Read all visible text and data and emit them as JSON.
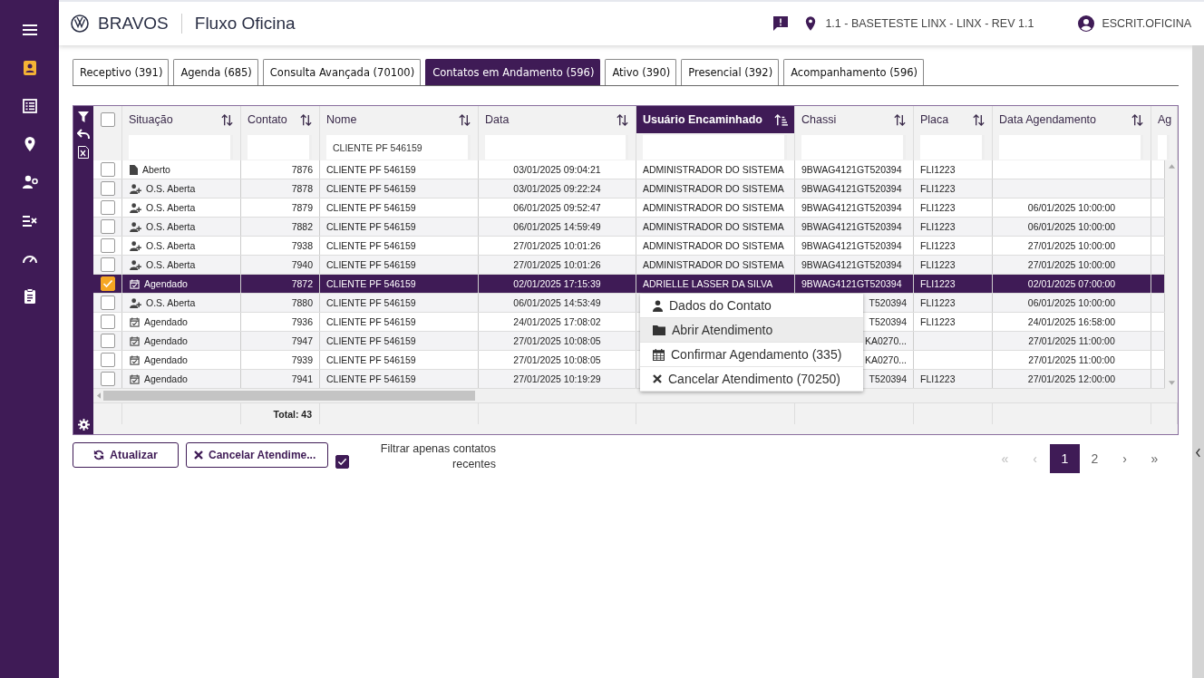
{
  "sidebar": {
    "items": [
      {
        "kind": "menu",
        "selected": false
      },
      {
        "kind": "contact",
        "selected": true
      },
      {
        "kind": "list",
        "selected": false
      },
      {
        "kind": "pin",
        "selected": false
      },
      {
        "kind": "user-gear",
        "selected": false
      },
      {
        "kind": "checklist",
        "selected": false
      },
      {
        "kind": "gauge",
        "selected": false
      },
      {
        "kind": "clipboard",
        "selected": false
      }
    ]
  },
  "header": {
    "brand": "BRAVOS",
    "title": "Fluxo Oficina",
    "location": "1.1 - BASETESTE LINX - LINX - REV 1.1",
    "user": "ESCRIT.OFICINA"
  },
  "tabs": [
    {
      "label": "Receptivo (391)",
      "selected": false
    },
    {
      "label": "Agenda (685)",
      "selected": false
    },
    {
      "label": "Consulta Avançada (70100)",
      "selected": false
    },
    {
      "label": "Contatos em Andamento (596)",
      "selected": true
    },
    {
      "label": "Ativo (390)",
      "selected": false
    },
    {
      "label": "Presencial (392)",
      "selected": false
    },
    {
      "label": "Acompanhamento (596)",
      "selected": false
    }
  ],
  "table": {
    "columns": [
      {
        "label": "Situação",
        "selected": false
      },
      {
        "label": "Contato",
        "selected": false
      },
      {
        "label": "Nome",
        "selected": false,
        "filter": "CLIENTE PF 546159"
      },
      {
        "label": "Data",
        "selected": false
      },
      {
        "label": "Usuário Encaminhado",
        "selected": true
      },
      {
        "label": "Chassi",
        "selected": false
      },
      {
        "label": "Placa",
        "selected": false
      },
      {
        "label": "Data Agendamento",
        "selected": false
      },
      {
        "label": "Ag",
        "selected": false
      }
    ],
    "select_all_checked": false,
    "rows": [
      {
        "checked": false,
        "selected": false,
        "kind": "open",
        "status": "Aberto",
        "contato": "7876",
        "nome": "CLIENTE PF 546159",
        "data": "03/01/2025 09:04:21",
        "usuario": "ADMINISTRADOR DO SISTEMA",
        "chassi": "9BWAG4121GT520394",
        "placa": "FLI1223"
      },
      {
        "checked": false,
        "selected": false,
        "kind": "os",
        "status": "O.S. Aberta",
        "contato": "7878",
        "nome": "CLIENTE PF 546159",
        "data": "03/01/2025 09:22:24",
        "usuario": "ADMINISTRADOR DO SISTEMA",
        "chassi": "9BWAG4121GT520394",
        "placa": "FLI1223"
      },
      {
        "checked": false,
        "selected": false,
        "kind": "os",
        "status": "O.S. Aberta",
        "contato": "7879",
        "nome": "CLIENTE PF 546159",
        "data": "06/01/2025 09:52:47",
        "usuario": "ADMINISTRADOR DO SISTEMA",
        "chassi": "9BWAG4121GT520394",
        "placa": "FLI1223",
        "agendamento": "06/01/2025 10:00:00"
      },
      {
        "checked": false,
        "selected": false,
        "kind": "os",
        "status": "O.S. Aberta",
        "contato": "7882",
        "nome": "CLIENTE PF 546159",
        "data": "06/01/2025 14:59:49",
        "usuario": "ADMINISTRADOR DO SISTEMA",
        "chassi": "9BWAG4121GT520394",
        "placa": "FLI1223",
        "agendamento": "06/01/2025 10:00:00"
      },
      {
        "checked": false,
        "selected": false,
        "kind": "os",
        "status": "O.S. Aberta",
        "contato": "7938",
        "nome": "CLIENTE PF 546159",
        "data": "27/01/2025 10:01:26",
        "usuario": "ADMINISTRADOR DO SISTEMA",
        "chassi": "9BWAG4121GT520394",
        "placa": "FLI1223",
        "agendamento": "27/01/2025 10:00:00"
      },
      {
        "checked": false,
        "selected": false,
        "kind": "os",
        "status": "O.S. Aberta",
        "contato": "7940",
        "nome": "CLIENTE PF 546159",
        "data": "27/01/2025 10:01:26",
        "usuario": "ADMINISTRADOR DO SISTEMA",
        "chassi": "9BWAG4121GT520394",
        "placa": "FLI1223",
        "agendamento": "27/01/2025 10:00:00"
      },
      {
        "checked": true,
        "selected": true,
        "kind": "scheduled",
        "status": "Agendado",
        "contato": "7872",
        "nome": "CLIENTE PF 546159",
        "data": "02/01/2025 17:15:39",
        "usuario": "ADRIELLE LASSER DA SILVA",
        "chassi": "9BWAG4121GT520394",
        "placa": "FLI1223",
        "agendamento": "02/01/2025 07:00:00"
      },
      {
        "checked": false,
        "selected": false,
        "kind": "os",
        "status": "O.S. Aberta",
        "contato": "7880",
        "nome": "CLIENTE PF 546159",
        "data": "06/01/2025 14:53:49",
        "chassi": "T520394",
        "chassi_partial": true,
        "placa": "FLI1223",
        "agendamento": "06/01/2025 10:00:00"
      },
      {
        "checked": false,
        "selected": false,
        "kind": "scheduled",
        "status": "Agendado",
        "contato": "7936",
        "nome": "CLIENTE PF 546159",
        "data": "24/01/2025 17:08:02",
        "chassi": "T520394",
        "chassi_partial": true,
        "placa": "FLI1223",
        "agendamento": "24/01/2025 16:58:00"
      },
      {
        "checked": false,
        "selected": false,
        "kind": "scheduled",
        "status": "Agendado",
        "contato": "7947",
        "nome": "CLIENTE PF 546159",
        "data": "27/01/2025 10:08:05",
        "chassi": "KA0270...",
        "chassi_partial": true,
        "agendamento": "27/01/2025 11:00:00"
      },
      {
        "checked": false,
        "selected": false,
        "kind": "scheduled",
        "status": "Agendado",
        "contato": "7939",
        "nome": "CLIENTE PF 546159",
        "data": "27/01/2025 10:08:05",
        "chassi": "KA0270...",
        "chassi_partial": true,
        "agendamento": "27/01/2025 11:00:00"
      },
      {
        "checked": false,
        "selected": false,
        "kind": "scheduled",
        "status": "Agendado",
        "contato": "7941",
        "nome": "CLIENTE PF 546159",
        "data": "27/01/2025 10:19:29",
        "chassi": "T520394",
        "chassi_partial": true,
        "placa": "FLI1223",
        "agendamento": "27/01/2025 12:00:00"
      }
    ],
    "total": "Total: 43"
  },
  "context_menu": {
    "items": [
      {
        "kind": "user",
        "label": "Dados do Contato",
        "selected": false
      },
      {
        "kind": "folder",
        "label": "Abrir Atendimento",
        "selected": true
      },
      {
        "kind": "calendar",
        "label": "Confirmar Agendamento (335)",
        "selected": false
      },
      {
        "kind": "cancel",
        "label": "Cancelar Atendimento (70250)",
        "selected": false
      }
    ]
  },
  "actions": [
    {
      "kind": "refresh",
      "label": "Atualizar"
    },
    {
      "kind": "cancel",
      "label": "Cancelar Atendime..."
    }
  ],
  "recent_filter": {
    "checked": true,
    "label": "Filtrar apenas contatos recentes"
  },
  "pagination": {
    "first": "«",
    "prev": "‹",
    "next": "›",
    "last": "»",
    "first_disabled": true,
    "prev_disabled": true,
    "next_disabled": false,
    "last_disabled": false,
    "pages": [
      {
        "label": "1",
        "selected": true
      },
      {
        "label": "2",
        "selected": false
      }
    ]
  }
}
